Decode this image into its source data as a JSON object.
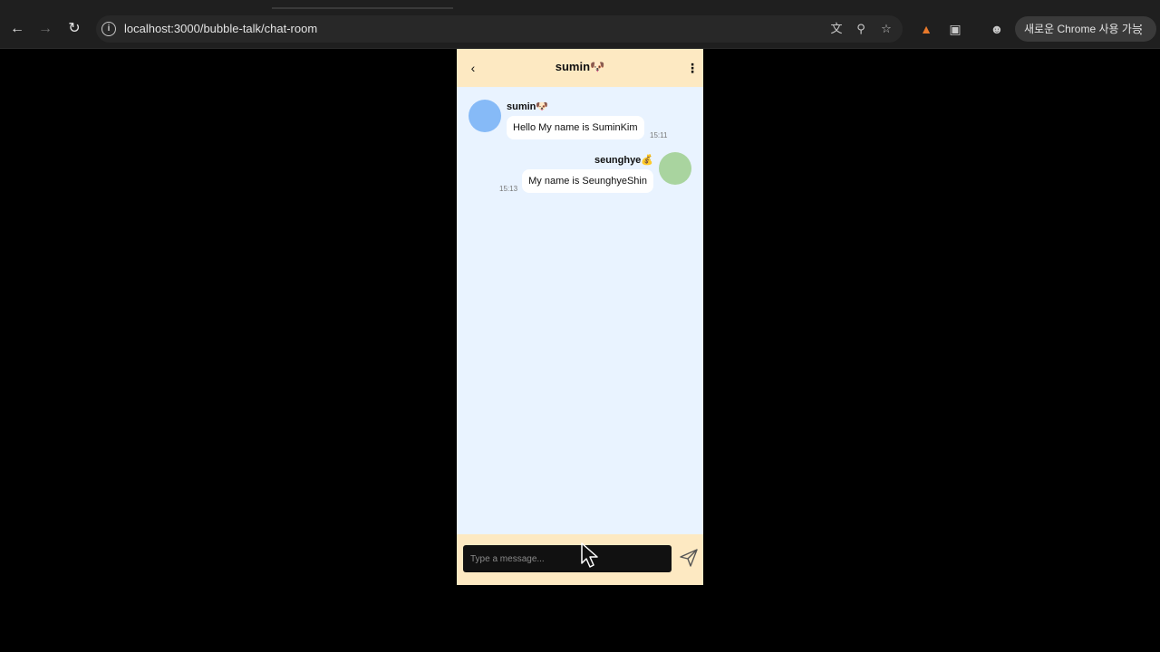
{
  "browser": {
    "url": "localhost:3000/bubble-talk/chat-room",
    "update_label": "새로운 Chrome 사용 가능",
    "icons": [
      "back-arrow-icon",
      "forward-arrow-icon",
      "reload-icon",
      "site-info-icon",
      "translate-icon",
      "zoom-icon",
      "bookmark-star-icon",
      "metamask-fox-icon",
      "extensions-puzzle-icon",
      "profile-avatar-icon",
      "more-vert-icon"
    ]
  },
  "chat": {
    "title": "sumin🐶",
    "input_placeholder": "Type a message...",
    "messages": [
      {
        "sender": "sumin🐶",
        "text": "Hello My name is SuminKim",
        "time": "15:11",
        "side": "left"
      },
      {
        "sender": "seunghye💰",
        "text": "My name is SeunghyeShin",
        "time": "15:13",
        "side": "right"
      }
    ]
  },
  "colors": {
    "header_bg": "#fde9c2",
    "chat_bg": "#e9f3ff",
    "avatar_sumin": "#86baf7",
    "avatar_seunghye": "#a9d49f",
    "input_bg": "#111111"
  }
}
